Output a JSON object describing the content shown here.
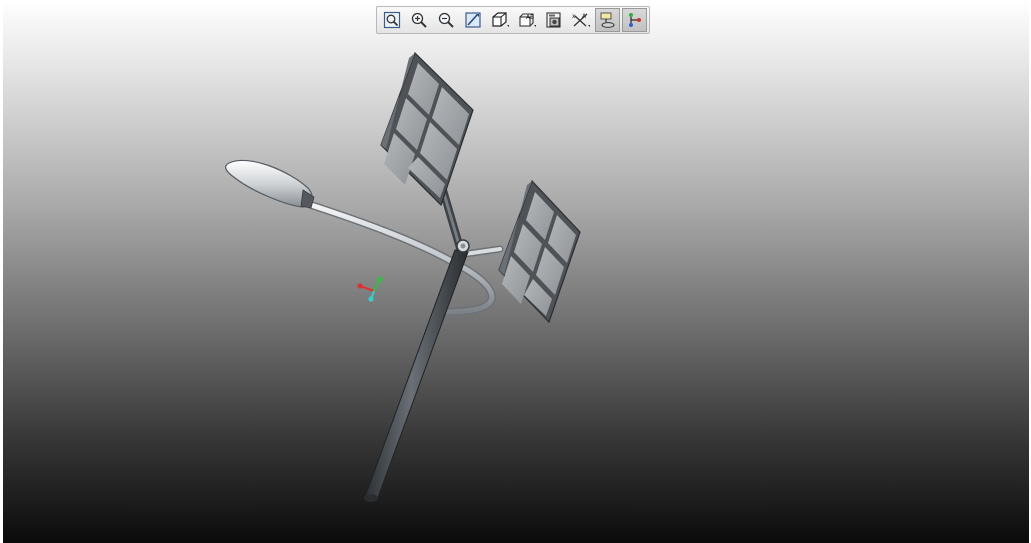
{
  "app": {
    "title": ""
  },
  "toolbar": {
    "buttons": [
      {
        "name": "refit",
        "icon": "refit-icon",
        "active": false
      },
      {
        "name": "zoom-in",
        "icon": "zoom-in-icon",
        "active": false
      },
      {
        "name": "zoom-out",
        "icon": "zoom-out-icon",
        "active": false
      },
      {
        "name": "repaint",
        "icon": "repaint-icon",
        "active": false
      },
      {
        "name": "display-style",
        "icon": "shaded-cube-icon",
        "active": false
      },
      {
        "name": "saved-views",
        "icon": "saved-views-icon",
        "active": false
      },
      {
        "name": "view-manager",
        "icon": "view-manager-icon",
        "active": false
      },
      {
        "name": "datum-display",
        "icon": "datum-display-icon",
        "active": false
      },
      {
        "name": "annotation-display",
        "icon": "annotation-display-icon",
        "active": true
      },
      {
        "name": "spin-center",
        "icon": "spin-center-icon",
        "active": true
      }
    ]
  },
  "colors": {
    "gradient_top": "#ffffff",
    "gradient_bottom": "#0b0b0b",
    "pole": "#4a4f55",
    "panel_frame": "#5a5e63",
    "panel_cell": "#9ea2a6",
    "arm": "#d0d4d8",
    "axis_x": "#e03030",
    "axis_y": "#30c040",
    "axis_z": "#30d0d0"
  },
  "model": {
    "description_icon": "solar-street-light-model"
  }
}
